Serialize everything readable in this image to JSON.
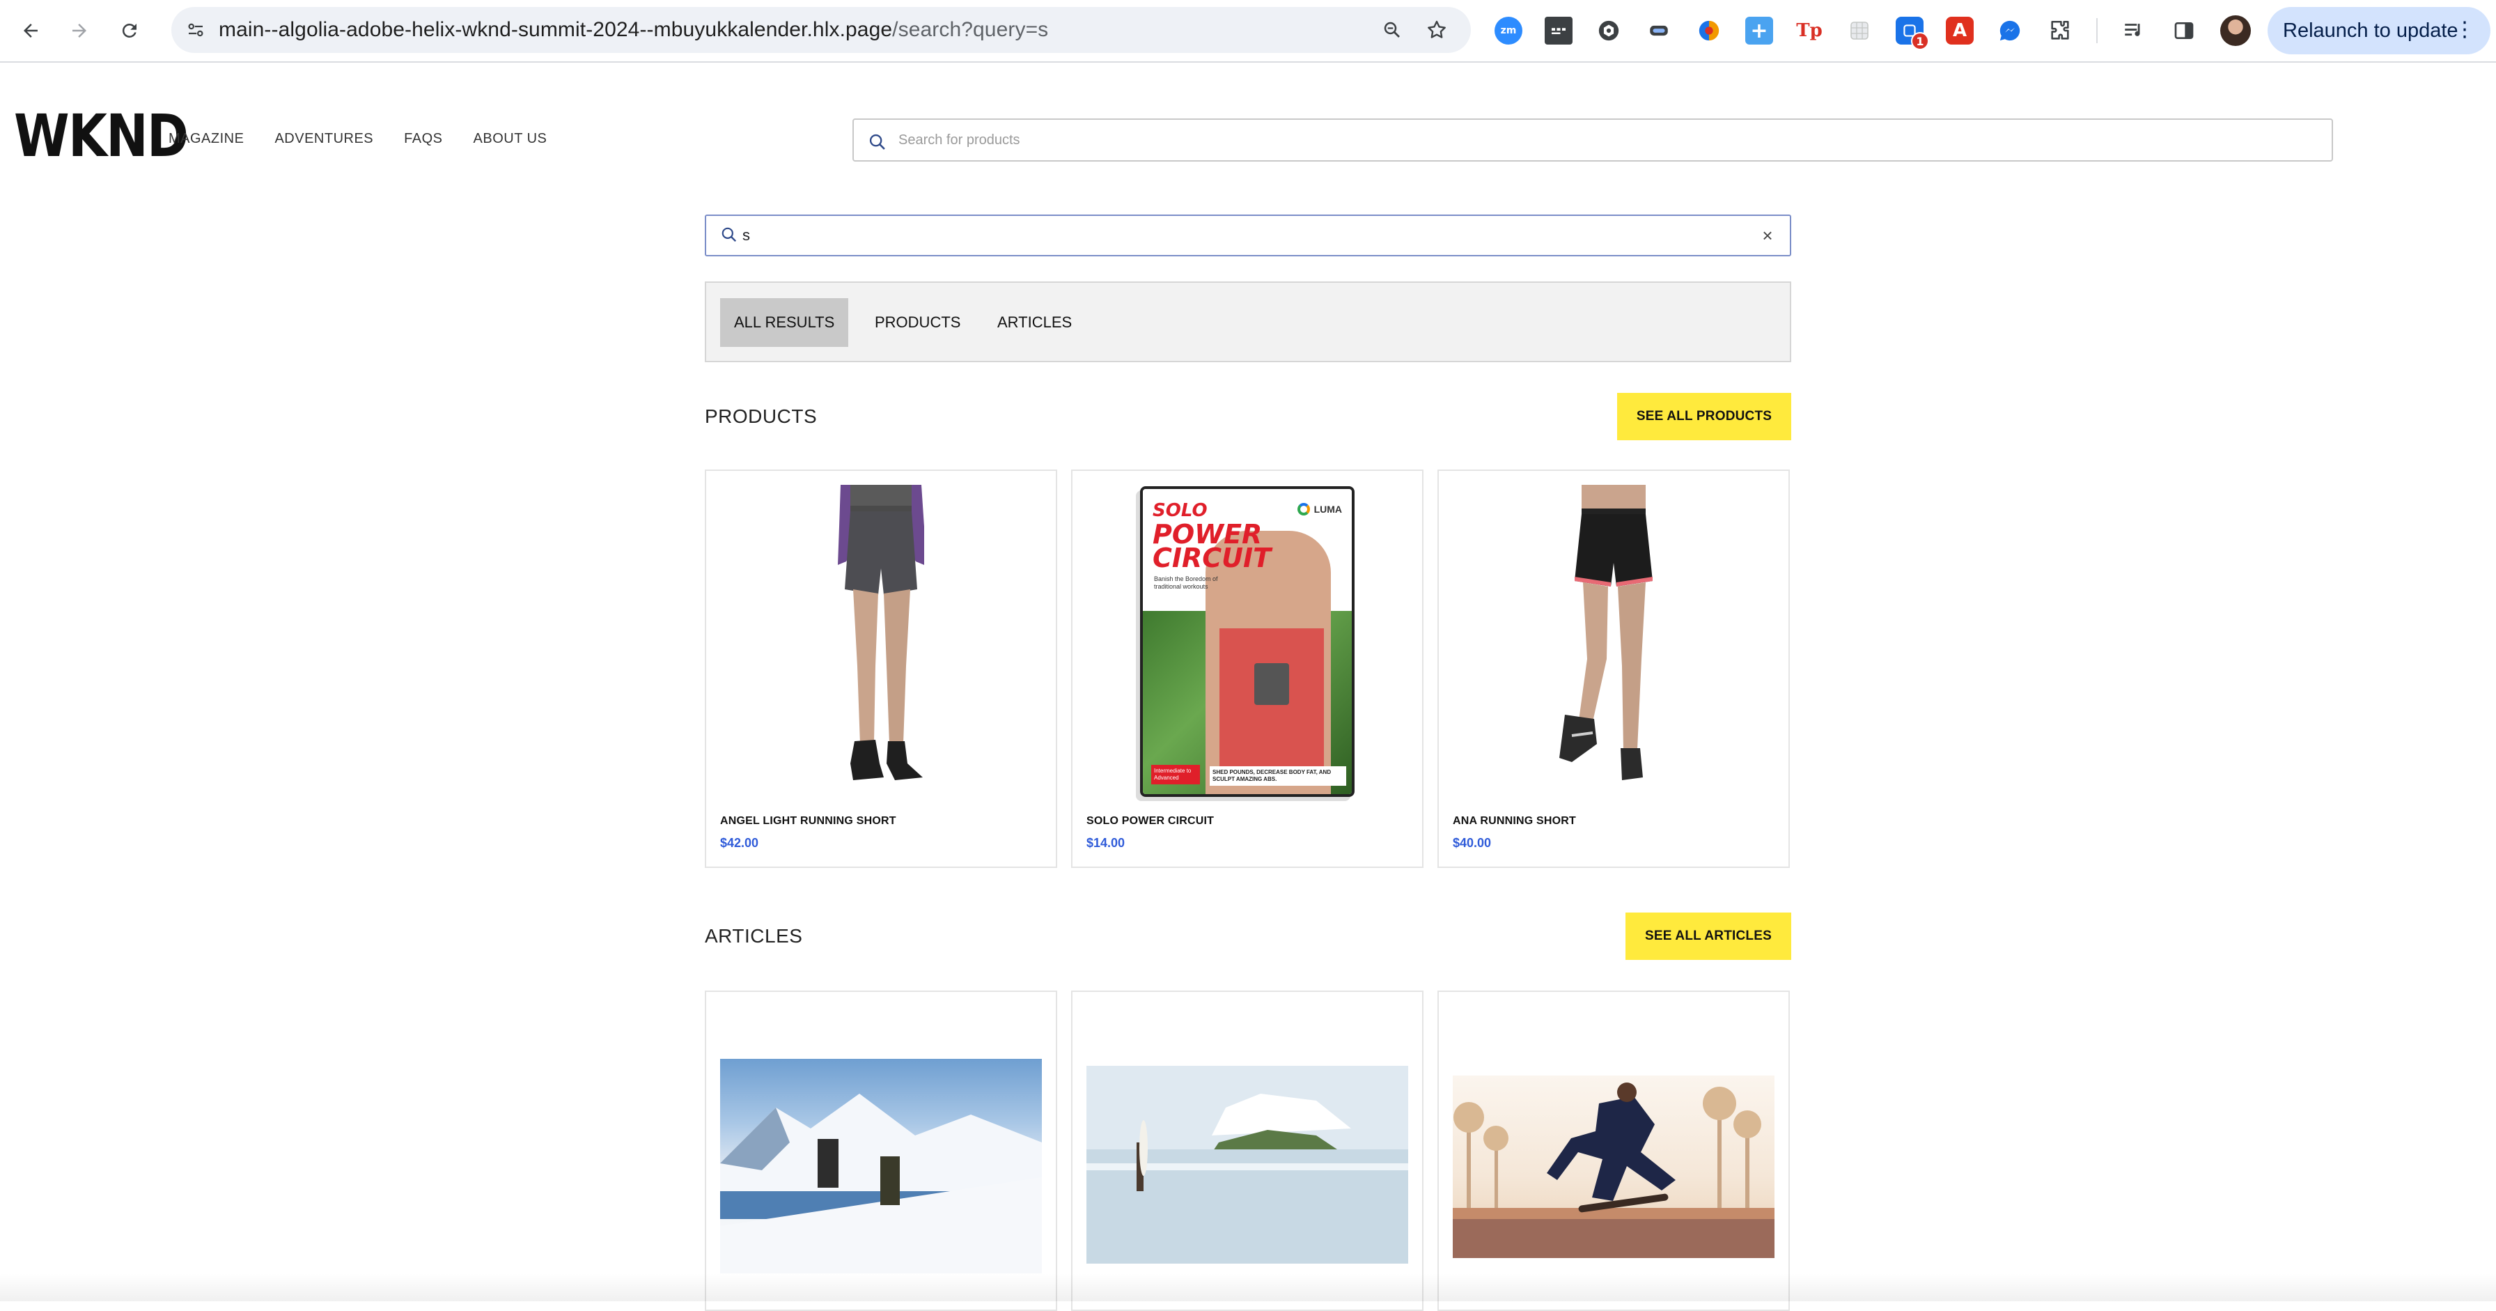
{
  "browser": {
    "url_host": "main--algolia-adobe-helix-wknd-summit-2024--mbuyukkalender.hlx.page",
    "url_path": "/search?query=s",
    "relaunch_label": "Relaunch to update",
    "extension_badge": "1",
    "extensions": [
      "zoom-icon",
      "notes-icon",
      "shield-icon",
      "gamepad-icon",
      "color-wheel-icon",
      "plus-icon",
      "tp-icon",
      "grid-icon",
      "badge-extension-icon",
      "acrobat-icon",
      "messenger-icon",
      "puzzle-icon"
    ],
    "ext_labels": {
      "zoom": "zm",
      "tp": "Tp",
      "acrobat": "A"
    }
  },
  "site": {
    "logo": "WKND",
    "nav": [
      "MAGAZINE",
      "ADVENTURES",
      "FAQS",
      "ABOUT US"
    ],
    "header_search_placeholder": "Search for products"
  },
  "search": {
    "query": "s",
    "clear_symbol": "×"
  },
  "tabs": [
    "ALL RESULTS",
    "PRODUCTS",
    "ARTICLES"
  ],
  "active_tab": "ALL RESULTS",
  "products": {
    "title": "PRODUCTS",
    "see_all": "SEE ALL PRODUCTS",
    "items": [
      {
        "name": "ANGEL LIGHT RUNNING SHORT",
        "price": "$42.00"
      },
      {
        "name": "SOLO POWER CIRCUIT",
        "price": "$14.00"
      },
      {
        "name": "ANA RUNNING SHORT",
        "price": "$40.00"
      }
    ],
    "dvd": {
      "brand": "LUMA",
      "title_line1": "SOLO",
      "title_line2": "POWER",
      "title_line3": "CIRCUIT",
      "tagline": "Banish the Boredom of traditional workouts",
      "level": "Intermediate to Advanced",
      "bottom_text": "SHED POUNDS, DECREASE BODY FAT, AND SCULPT AMAZING ABS."
    }
  },
  "articles": {
    "title": "ARTICLES",
    "see_all": "SEE ALL ARTICLES"
  },
  "colors": {
    "accent_yellow": "#ffea3d",
    "price_blue": "#2f5bd9",
    "active_tab": "#c9c9c9"
  }
}
